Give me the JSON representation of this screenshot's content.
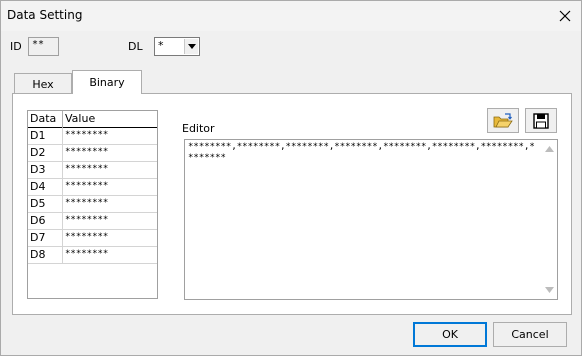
{
  "window": {
    "title": "Data Setting"
  },
  "id_field": {
    "label": "ID",
    "value": "**"
  },
  "dl_field": {
    "label": "DL",
    "value": "*"
  },
  "tabs": [
    {
      "label": "Hex",
      "active": false
    },
    {
      "label": "Binary",
      "active": true
    }
  ],
  "grid": {
    "headers": [
      "Data",
      "Value"
    ],
    "rows": [
      {
        "data": "D1",
        "value": "********"
      },
      {
        "data": "D2",
        "value": "********"
      },
      {
        "data": "D3",
        "value": "********"
      },
      {
        "data": "D4",
        "value": "********"
      },
      {
        "data": "D5",
        "value": "********"
      },
      {
        "data": "D6",
        "value": "********"
      },
      {
        "data": "D7",
        "value": "********"
      },
      {
        "data": "D8",
        "value": "********"
      }
    ]
  },
  "editor": {
    "label": "Editor",
    "text": "********,********,********,********,********,********,********,********"
  },
  "icons": {
    "open": "folder-open-icon",
    "save": "floppy-disk-icon",
    "close": "close-icon"
  },
  "buttons": {
    "ok": "OK",
    "cancel": "Cancel"
  },
  "colors": {
    "accent": "#0078d7",
    "folder": "#e8b93a"
  }
}
